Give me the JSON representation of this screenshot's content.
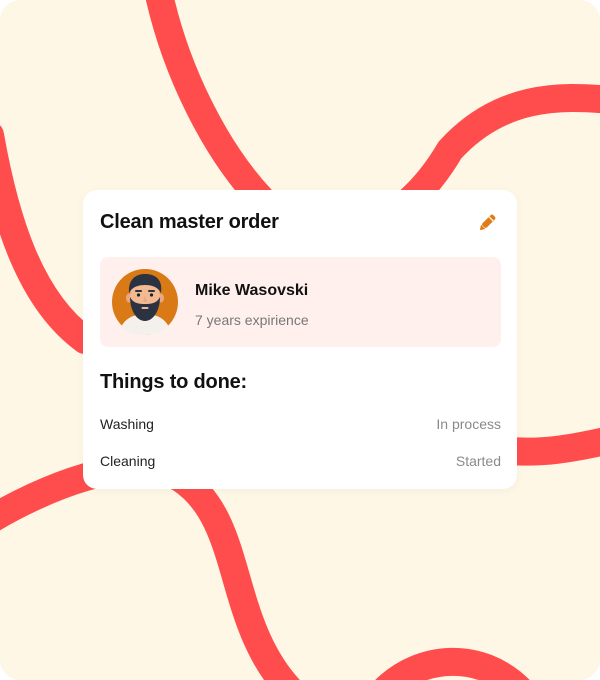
{
  "card": {
    "title": "Clean master order",
    "edit_icon": "pencil-icon"
  },
  "profile": {
    "name": "Mike Wasovski",
    "experience": "7 years expirience",
    "avatar_icon": "bearded-man-avatar"
  },
  "tasks_section": {
    "title": "Things to done:",
    "items": [
      {
        "name": "Washing",
        "status": "In process"
      },
      {
        "name": "Cleaning",
        "status": "Started"
      }
    ]
  },
  "colors": {
    "background": "#fef7e6",
    "ribbon": "#ff4d4d",
    "card": "#ffffff",
    "profile_bg": "#fff0ee",
    "accent_pencil": "#e07b16"
  }
}
